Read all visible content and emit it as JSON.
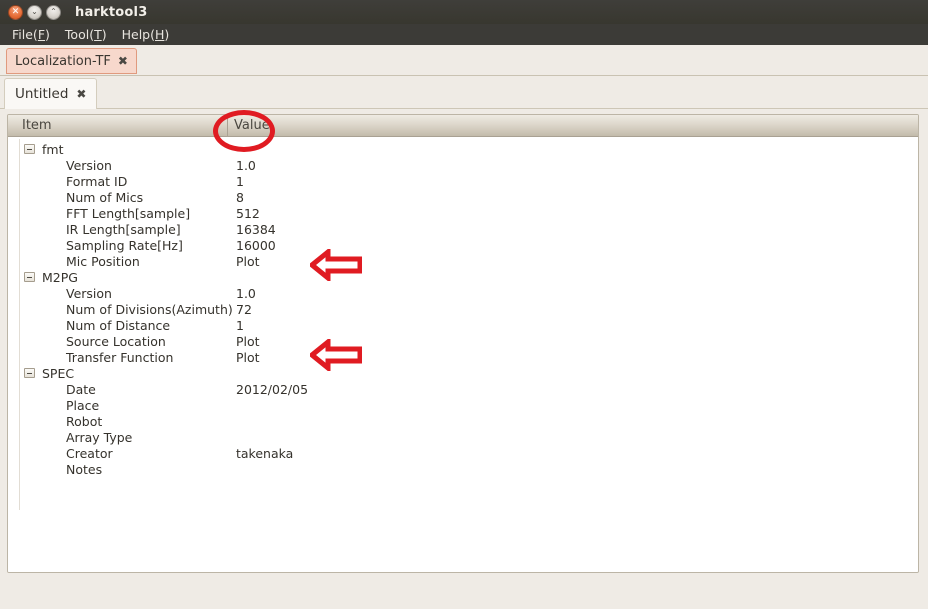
{
  "window": {
    "title": "harktool3",
    "buttons": [
      {
        "name": "close",
        "glyph": "✕"
      },
      {
        "name": "minimize",
        "glyph": "⌄"
      },
      {
        "name": "maximize",
        "glyph": "⌃"
      }
    ]
  },
  "menubar": {
    "items": [
      {
        "label": "File",
        "mnemonic": "F"
      },
      {
        "label": "Tool",
        "mnemonic": "T"
      },
      {
        "label": "Help",
        "mnemonic": "H"
      }
    ]
  },
  "tabs_outer": [
    {
      "label": "Localization-TF",
      "close_glyph": "✖",
      "active": true
    }
  ],
  "tabs_inner": [
    {
      "label": "Untitled",
      "close_glyph": "✖",
      "active": true
    }
  ],
  "table": {
    "columns": [
      {
        "key": "item",
        "label": "Item"
      },
      {
        "key": "value",
        "label": "Value"
      }
    ],
    "rows": [
      {
        "type": "group",
        "item": "fmt",
        "value": "",
        "expanded": true
      },
      {
        "type": "child",
        "item": "Version",
        "value": "1.0"
      },
      {
        "type": "child",
        "item": "Format ID",
        "value": "1"
      },
      {
        "type": "child",
        "item": "Num of Mics",
        "value": "8"
      },
      {
        "type": "child",
        "item": "FFT Length[sample]",
        "value": "512"
      },
      {
        "type": "child",
        "item": "IR Length[sample]",
        "value": "16384"
      },
      {
        "type": "child",
        "item": "Sampling Rate[Hz]",
        "value": "16000"
      },
      {
        "type": "child",
        "item": "Mic Position",
        "value": "Plot"
      },
      {
        "type": "group",
        "item": "M2PG",
        "value": "",
        "expanded": true
      },
      {
        "type": "child",
        "item": "Version",
        "value": "1.0"
      },
      {
        "type": "child",
        "item": "Num of Divisions(Azimuth)",
        "value": "72"
      },
      {
        "type": "child",
        "item": "Num of Distance",
        "value": "1"
      },
      {
        "type": "child",
        "item": "Source Location",
        "value": "Plot"
      },
      {
        "type": "child",
        "item": "Transfer Function",
        "value": "Plot"
      },
      {
        "type": "group",
        "item": "SPEC",
        "value": "",
        "expanded": true
      },
      {
        "type": "child",
        "item": "Date",
        "value": "2012/02/05"
      },
      {
        "type": "child",
        "item": "Place",
        "value": ""
      },
      {
        "type": "child",
        "item": "Robot",
        "value": ""
      },
      {
        "type": "child",
        "item": "Array Type",
        "value": ""
      },
      {
        "type": "child",
        "item": "Creator",
        "value": "takenaka"
      },
      {
        "type": "child",
        "item": "Notes",
        "value": ""
      }
    ]
  },
  "annotations": {
    "color": "#e01b22",
    "ellipse": {
      "target": "Value column header"
    },
    "arrows": [
      {
        "direction": "left",
        "target": "Mic Position Plot"
      },
      {
        "direction": "left",
        "target": "Source Location / Transfer Function Plot"
      }
    ]
  },
  "colors": {
    "titlebar": "#3c3b37",
    "window_background": "#efebe5",
    "panel_background": "#ffffff",
    "active_tab": "#f7d8cc",
    "annotation_red": "#e01b22"
  }
}
